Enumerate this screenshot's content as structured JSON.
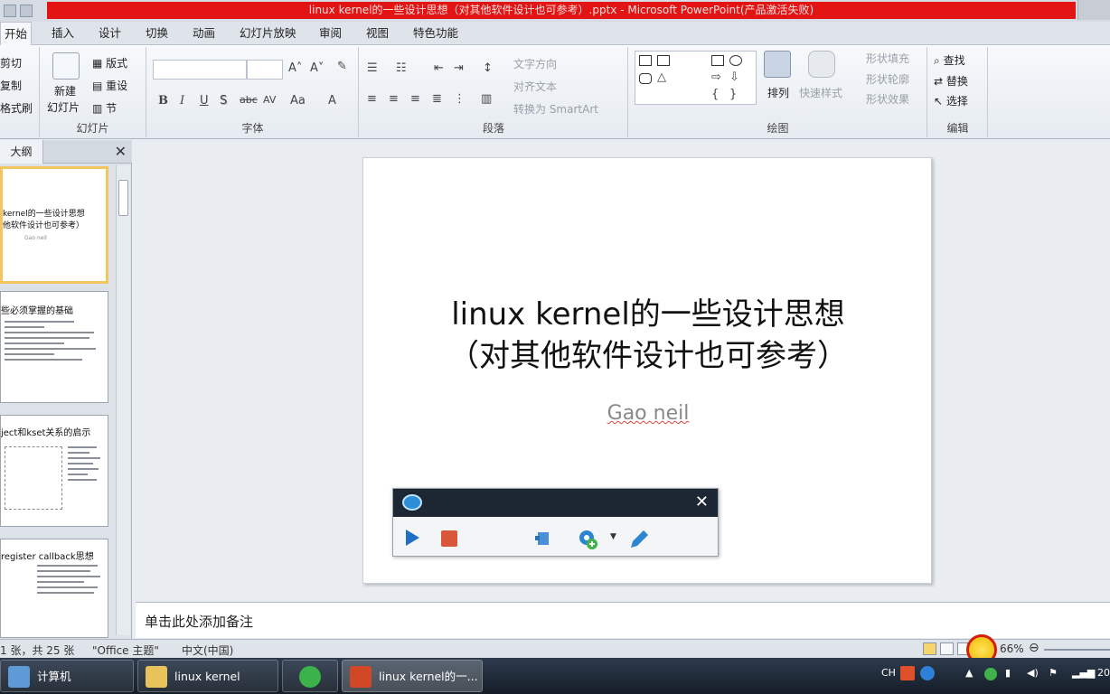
{
  "window": {
    "title": "linux kernel的一些设计思想（对其他软件设计也可参考）.pptx - Microsoft PowerPoint(产品激活失败)"
  },
  "ribbon_tabs": [
    "开始",
    "插入",
    "设计",
    "切换",
    "动画",
    "幻灯片放映",
    "审阅",
    "视图",
    "特色功能"
  ],
  "clipboard": {
    "cut": "剪切",
    "copy": "复制",
    "format_painter": "格式刷"
  },
  "slides_group": {
    "new_slide_top": "新建",
    "new_slide_bottom": "幻灯片",
    "layout": "版式",
    "reset": "重设",
    "section": "节",
    "label": "幻灯片"
  },
  "font_group": {
    "label": "字体"
  },
  "paragraph_group": {
    "text_direction": "文字方向",
    "align_text": "对齐文本",
    "convert_smartart": "转换为 SmartArt",
    "label": "段落"
  },
  "drawing_group": {
    "arrange": "排列",
    "quick_styles": "快速样式",
    "shape_fill": "形状填充",
    "shape_outline": "形状轮廓",
    "shape_effects": "形状效果",
    "label": "绘图"
  },
  "editing_group": {
    "find": "查找",
    "replace": "替换",
    "select": "选择",
    "label": "编辑"
  },
  "left_panel": {
    "tab_outline": "大纲",
    "thumbnails": [
      {
        "title_line1": "kernel的一些设计思想",
        "title_line2": "他软件设计也可参考）",
        "author": "Gao neil"
      },
      {
        "title_line1": "些必须掌握的基础"
      },
      {
        "title_line1": "ject和kset关系的启示"
      },
      {
        "title_line1": "register callback思想"
      }
    ]
  },
  "slide": {
    "title_line1": "linux kernel的一些设计思想",
    "title_line2": "（对其他软件设计也可参考）",
    "subtitle": "Gao neil"
  },
  "notes_placeholder": "单击此处添加备注",
  "status_bar": {
    "slide_info": "1 张，共 25 张",
    "theme": "\"Office 主题\"",
    "language": "中文(中国)",
    "zoom": "66%"
  },
  "taskbar": {
    "computer": "计算机",
    "folder": "linux kernel",
    "ppt": "linux kernel的一...",
    "ime": "CH",
    "clock_partial": "20"
  },
  "colors": {
    "title_band": "#e21414",
    "highlight": "#d51b0a",
    "rec_header": "#1d2733",
    "selected_thumb": "#f2c55e"
  }
}
